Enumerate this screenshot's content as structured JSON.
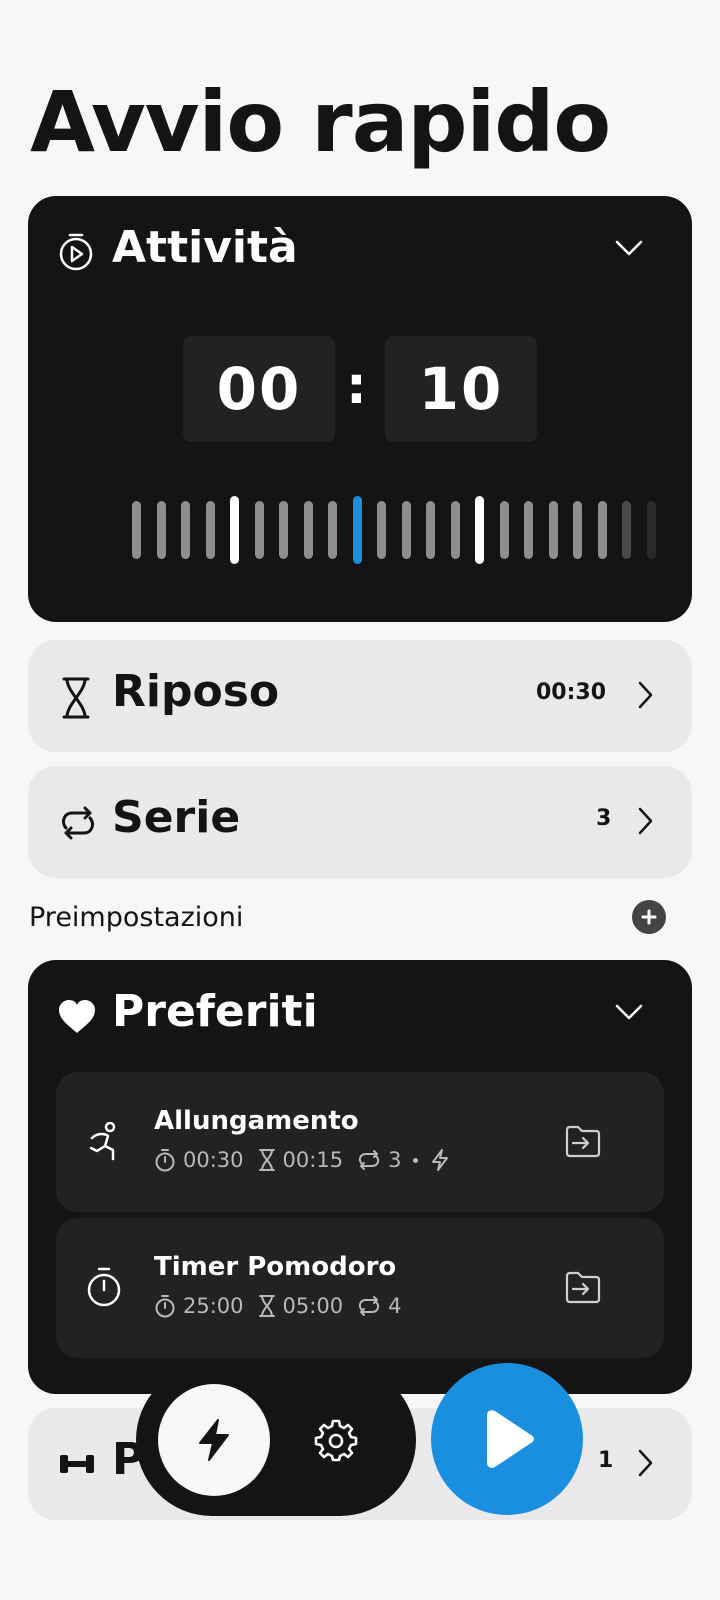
{
  "page": {
    "title": "Avvio rapido"
  },
  "activity": {
    "label": "Attività",
    "icon": "timer-play-icon",
    "minutes": "00",
    "colon": ":",
    "seconds": "10"
  },
  "rest": {
    "label": "Riposo",
    "icon": "hourglass-icon",
    "value": "00:30"
  },
  "sets": {
    "label": "Serie",
    "icon": "repeat-icon",
    "value": "3"
  },
  "presets_section": {
    "label": "Preimpostazioni",
    "add_icon": "plus-icon"
  },
  "favorites": {
    "label": "Preferiti",
    "icon": "heart-icon",
    "items": [
      {
        "name": "Allungamento",
        "icon": "stretching-icon",
        "work": "00:30",
        "rest": "00:15",
        "sets": "3",
        "flash": true
      },
      {
        "name": "Timer Pomodoro",
        "icon": "stopwatch-icon",
        "work": "25:00",
        "rest": "05:00",
        "sets": "4",
        "flash": false
      }
    ]
  },
  "bottom_row": {
    "label_partial": "P",
    "icon": "dumbbell-icon",
    "value": "1"
  },
  "nav": {
    "lightning_icon": "lightning-icon",
    "settings_icon": "gear-icon",
    "play_icon": "play-icon"
  },
  "colors": {
    "accent": "#1a8fe0",
    "dark_card": "#141414",
    "light_card": "#e9e8eb",
    "background": "#f8f7f5"
  }
}
